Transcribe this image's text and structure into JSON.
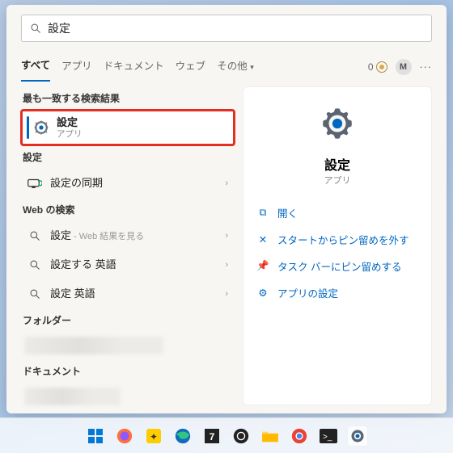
{
  "search": {
    "value": "設定",
    "placeholder": ""
  },
  "tabs": [
    "すべて",
    "アプリ",
    "ドキュメント",
    "ウェブ",
    "その他"
  ],
  "active_tab": 0,
  "points": "0",
  "user_initial": "M",
  "sections": {
    "best_match": "最も一致する検索結果",
    "settings": "設定",
    "web": "Web の検索",
    "folder": "フォルダー",
    "document": "ドキュメント"
  },
  "best": {
    "title": "設定",
    "subtitle": "アプリ"
  },
  "settings_items": [
    {
      "title": "設定の同期"
    }
  ],
  "web_items": [
    {
      "title": "設定",
      "hint": " - Web 結果を見る"
    },
    {
      "title": "設定する 英語"
    },
    {
      "title": "設定 英語"
    }
  ],
  "preview": {
    "title": "設定",
    "subtitle": "アプリ",
    "actions": [
      {
        "icon": "open",
        "label": "開く"
      },
      {
        "icon": "unpin-start",
        "label": "スタートからピン留めを外す"
      },
      {
        "icon": "pin-taskbar",
        "label": "タスク バーにピン留めする"
      },
      {
        "icon": "app-settings",
        "label": "アプリの設定"
      }
    ]
  },
  "taskbar": [
    "start",
    "firefox",
    "yellow",
    "edge",
    "seven",
    "obs",
    "explorer",
    "chrome",
    "terminal",
    "settings"
  ]
}
